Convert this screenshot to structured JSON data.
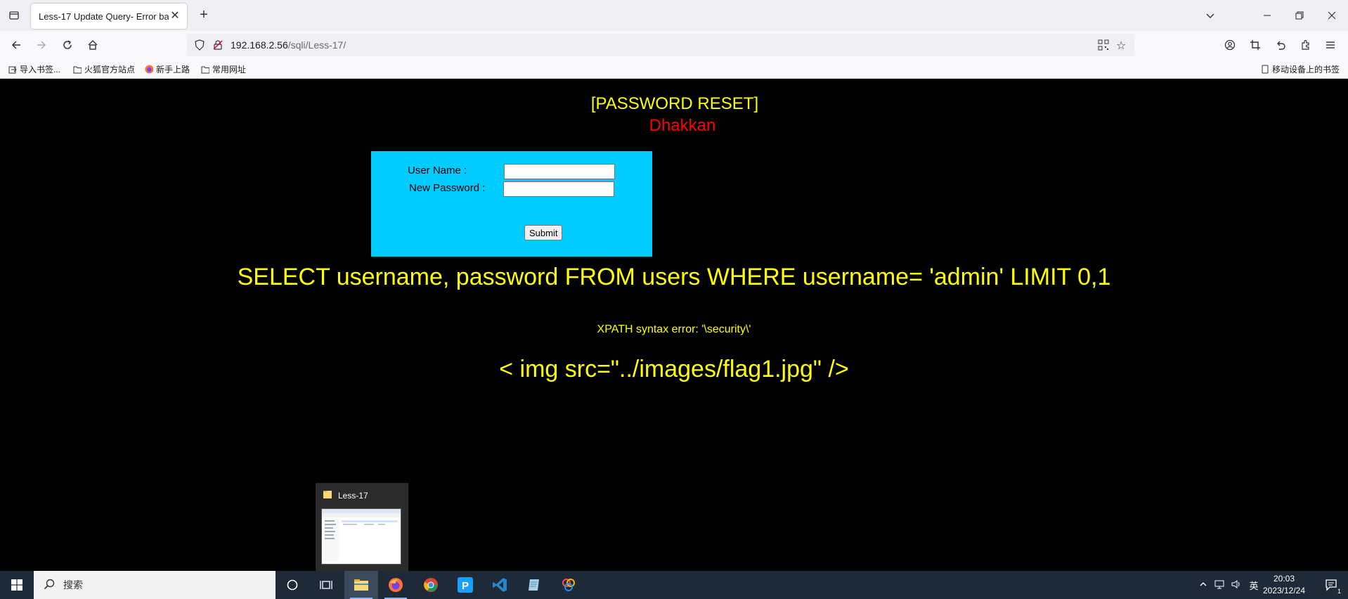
{
  "browser": {
    "tab_title": "Less-17 Update Query- Error bas",
    "url_host": "192.168.2.56",
    "url_path": "/sqli/Less-17/",
    "bookmarks": [
      {
        "label": "导入书签...",
        "icon": "import-icon"
      },
      {
        "label": "火狐官方站点",
        "icon": "folder-icon"
      },
      {
        "label": "新手上路",
        "icon": "firefox-icon"
      },
      {
        "label": "常用网址",
        "icon": "folder-icon"
      }
    ],
    "mobile_bookmarks": "移动设备上的书签"
  },
  "page": {
    "title": "[PASSWORD RESET]",
    "subtitle": "Dhakkan",
    "form": {
      "username_label": "User Name      :",
      "password_label": "New Password :",
      "username_value": "",
      "password_value": "",
      "submit_label": "Submit"
    },
    "query": "SELECT username, password FROM users WHERE username= 'admin' LIMIT 0,1",
    "error": "XPATH syntax error: '\\security\\'",
    "img_tag": "< img src=\"../images/flag1.jpg\" />"
  },
  "preview": {
    "title": "Less-17"
  },
  "taskbar": {
    "search_placeholder": "搜索",
    "ime": "英",
    "time": "20:03",
    "date": "2023/12/24",
    "notification_count": "1"
  },
  "colors": {
    "title": "#ffff00",
    "subtitle": "#ff0000",
    "form_bg": "#00ccff"
  }
}
